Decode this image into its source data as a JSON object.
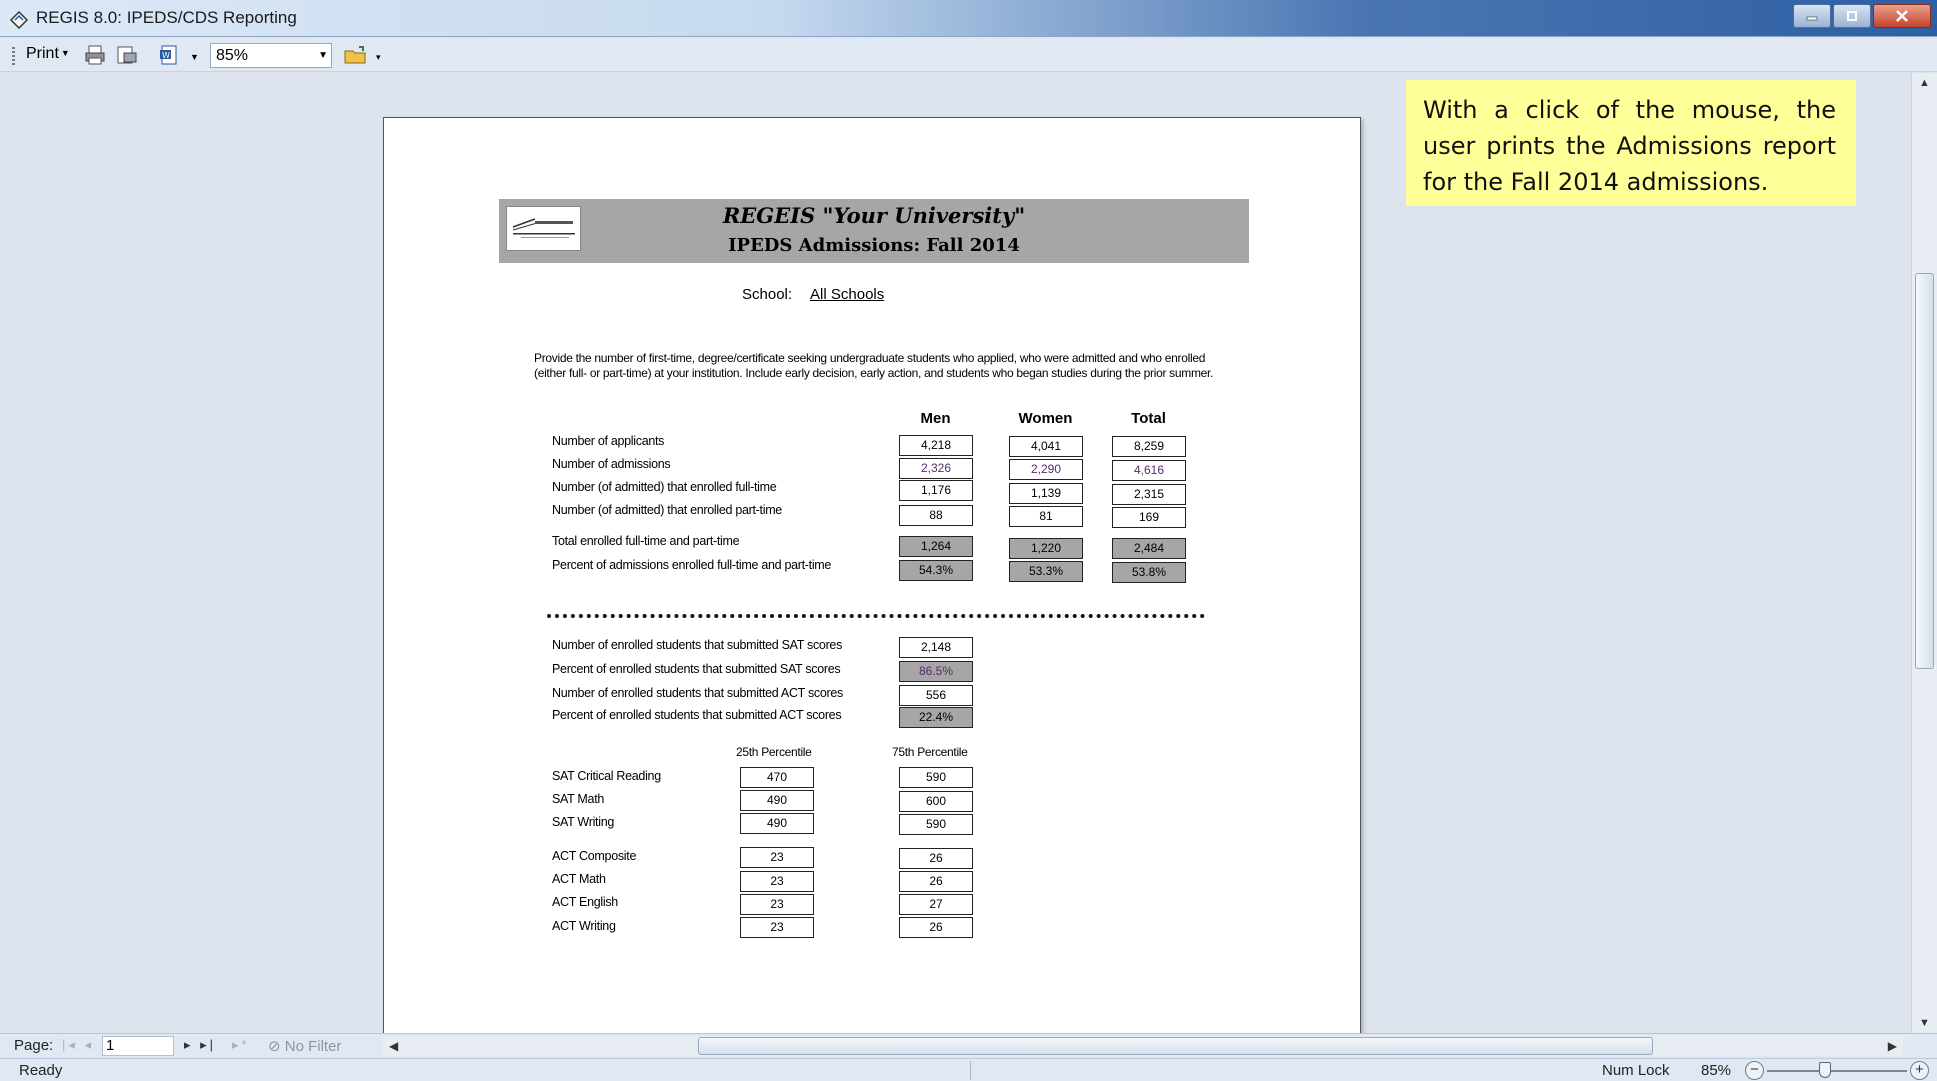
{
  "window": {
    "title": "REGIS 8.0: IPEDS/CDS Reporting"
  },
  "toolbar": {
    "print_label": "Print",
    "zoom_value": "85%",
    "icons": [
      "print-icon",
      "print-preview-icon",
      "export-word-icon",
      "open-folder-icon"
    ]
  },
  "callout": {
    "text": "With a click of the mouse, the user prints the Admissions report for the Fall 2014 admissions."
  },
  "report": {
    "title": "REGEIS \"Your University\"",
    "subtitle": "IPEDS Admissions: Fall 2014",
    "school_label": "School:",
    "school_value": "All Schools",
    "instructions": "Provide the number of first-time, degree/certificate seeking undergraduate students who applied, who were admitted and who enrolled (either full- or part-time) at your institution.   Include early decision, early action, and students who began studies during the prior summer.",
    "columns": [
      "Men",
      "Women",
      "Total"
    ],
    "admissions_rows": [
      {
        "label": "Number of applicants",
        "men": "4,218",
        "women": "4,041",
        "total": "8,259"
      },
      {
        "label": "Number of admissions",
        "men": "2,326",
        "women": "2,290",
        "total": "4,616"
      },
      {
        "label": "Number (of admitted) that enrolled full-time",
        "men": "1,176",
        "women": "1,139",
        "total": "2,315"
      },
      {
        "label": "Number (of admitted) that enrolled part-time",
        "men": "88",
        "women": "81",
        "total": "169"
      }
    ],
    "total_rows": [
      {
        "label": "Total enrolled full-time and part-time",
        "men": "1,264",
        "women": "1,220",
        "total": "2,484"
      },
      {
        "label": "Percent of admissions enrolled full-time and part-time",
        "men": "54.3%",
        "women": "53.3%",
        "total": "53.8%"
      }
    ],
    "test_rows": [
      {
        "label": "Number of enrolled students that submitted SAT scores",
        "value": "2,148"
      },
      {
        "label": "Percent of enrolled students that submitted SAT scores",
        "value": "86.5%"
      },
      {
        "label": "Number of enrolled students that submitted ACT scores",
        "value": "556"
      },
      {
        "label": "Percent of enrolled students that submitted ACT scores",
        "value": "22.4%"
      }
    ],
    "percentile_headers": [
      "25th Percentile",
      "75th Percentile"
    ],
    "sat_rows": [
      {
        "label": "SAT Critical Reading",
        "p25": "470",
        "p75": "590"
      },
      {
        "label": "SAT Math",
        "p25": "490",
        "p75": "600"
      },
      {
        "label": "SAT Writing",
        "p25": "490",
        "p75": "590"
      }
    ],
    "act_rows": [
      {
        "label": "ACT Composite",
        "p25": "23",
        "p75": "26"
      },
      {
        "label": "ACT Math",
        "p25": "23",
        "p75": "26"
      },
      {
        "label": "ACT English",
        "p25": "23",
        "p75": "27"
      },
      {
        "label": "ACT Writing",
        "p25": "23",
        "p75": "26"
      }
    ]
  },
  "navigation": {
    "page_label": "Page:",
    "page_value": "1",
    "filter_label": "No Filter"
  },
  "statusbar": {
    "ready": "Ready",
    "num_lock": "Num Lock",
    "zoom": "85%"
  }
}
